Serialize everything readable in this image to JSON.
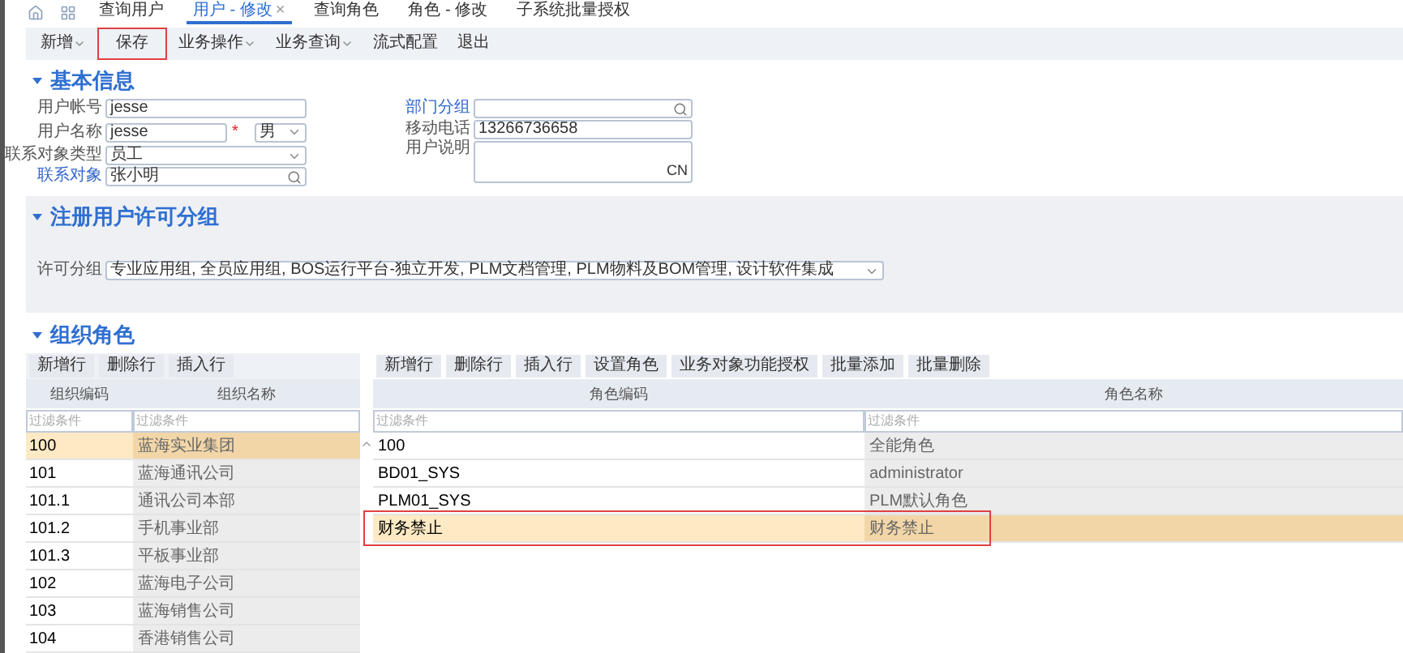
{
  "tabs": [
    {
      "label": "查询用户",
      "selected": false,
      "closable": false
    },
    {
      "label": "用户 - 修改",
      "selected": true,
      "closable": true
    },
    {
      "label": "查询角色",
      "selected": false,
      "closable": false
    },
    {
      "label": "角色 - 修改",
      "selected": false,
      "closable": false
    },
    {
      "label": "子系统批量授权",
      "selected": false,
      "closable": false
    }
  ],
  "close_glyph": "×",
  "toolbar": [
    {
      "label": "新增",
      "dropdown": true,
      "highlighted": false
    },
    {
      "label": "保存",
      "dropdown": false,
      "highlighted": true
    },
    {
      "label": "业务操作",
      "dropdown": true,
      "highlighted": false
    },
    {
      "label": "业务查询",
      "dropdown": true,
      "highlighted": false
    },
    {
      "label": "流式配置",
      "dropdown": false,
      "highlighted": false
    },
    {
      "label": "退出",
      "dropdown": false,
      "highlighted": false
    }
  ],
  "basic_info": {
    "title": "基本信息",
    "user_code": {
      "label": "用户帐号",
      "value": "jesse"
    },
    "user_name": {
      "label": "用户名称",
      "value": "jesse",
      "required_mark": "*"
    },
    "gender": {
      "value": "男"
    },
    "contact_type": {
      "label": "联系对象类型",
      "value": "员工"
    },
    "contact": {
      "label": "联系对象",
      "value": "张小明"
    },
    "department": {
      "label": "部门分组"
    },
    "mobile": {
      "label": "移动电话",
      "value": "13266736658"
    },
    "description": {
      "label": "用户说明",
      "suffix": "CN"
    }
  },
  "license": {
    "title": "注册用户许可分组",
    "label": "许可分组",
    "value": "专业应用组, 全员应用组, BOS运行平台-独立开发, PLM文档管理, PLM物料及BOM管理, 设计软件集成"
  },
  "org_roles": {
    "title": "组织角色",
    "org_toolbar": [
      "新增行",
      "删除行",
      "插入行"
    ],
    "org_table": {
      "columns": [
        "组织编码",
        "组织名称"
      ],
      "filters": [
        {
          "placeholder": "过滤条件"
        },
        {
          "placeholder": "过滤条件"
        }
      ],
      "rows": [
        {
          "code": "100",
          "name": "蓝海实业集团",
          "selected": true
        },
        {
          "code": "101",
          "name": "蓝海通讯公司",
          "selected": false
        },
        {
          "code": "101.1",
          "name": "通讯公司本部",
          "selected": false
        },
        {
          "code": "101.2",
          "name": "手机事业部",
          "selected": false
        },
        {
          "code": "101.3",
          "name": "平板事业部",
          "selected": false
        },
        {
          "code": "102",
          "name": "蓝海电子公司",
          "selected": false
        },
        {
          "code": "103",
          "name": "蓝海销售公司",
          "selected": false
        },
        {
          "code": "104",
          "name": "香港销售公司",
          "selected": false
        }
      ]
    },
    "role_toolbar": [
      "新增行",
      "删除行",
      "插入行",
      "设置角色",
      "业务对象功能授权",
      "批量添加",
      "批量删除"
    ],
    "role_table": {
      "columns": [
        "角色编码",
        "角色名称"
      ],
      "filters": [
        {
          "placeholder": "过滤条件"
        },
        {
          "placeholder": "过滤条件"
        }
      ],
      "rows": [
        {
          "code": "100",
          "name": "全能角色",
          "selected": false,
          "highlighted": false
        },
        {
          "code": "BD01_SYS",
          "name": "administrator",
          "selected": false,
          "highlighted": false
        },
        {
          "code": "PLM01_SYS",
          "name": "PLM默认角色",
          "selected": false,
          "highlighted": false
        },
        {
          "code": "财务禁止",
          "name": "财务禁止",
          "selected": true,
          "highlighted": true
        }
      ]
    }
  }
}
